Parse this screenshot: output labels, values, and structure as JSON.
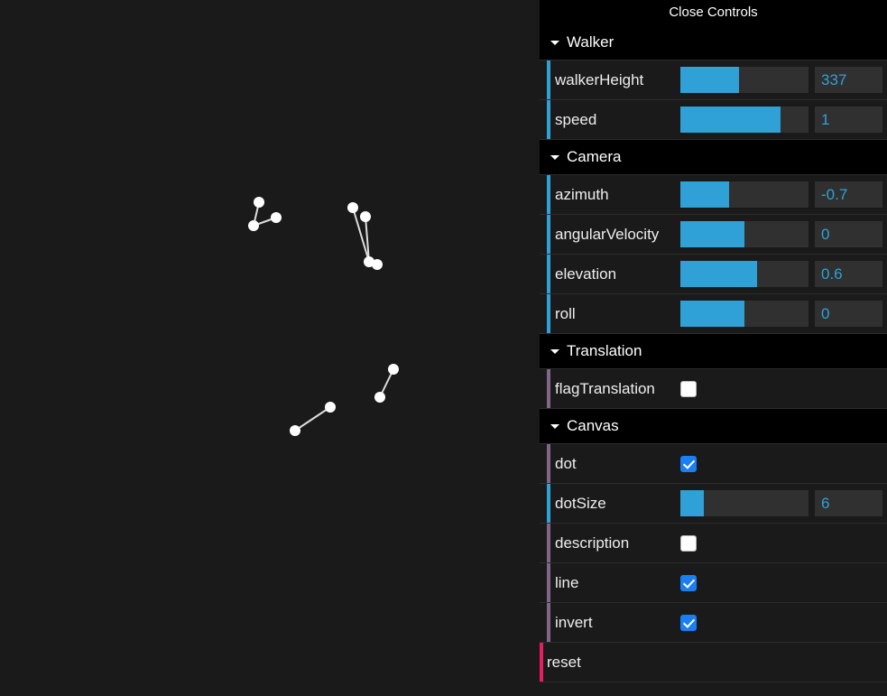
{
  "close_label": "Close Controls",
  "canvas": {
    "background": "#1a1a1a",
    "dot_color": "#ffffff",
    "line_color": "#dddddd",
    "dot_radius": 6,
    "clusters": [
      {
        "dots": [
          [
            287,
            224
          ],
          [
            281,
            250
          ],
          [
            306,
            241
          ]
        ],
        "lines": [
          [
            0,
            1
          ],
          [
            1,
            2
          ]
        ]
      },
      {
        "dots": [
          [
            391,
            230
          ],
          [
            405,
            240
          ],
          [
            409,
            290
          ],
          [
            418,
            293
          ]
        ],
        "lines": [
          [
            0,
            2
          ],
          [
            1,
            2
          ],
          [
            2,
            3
          ]
        ]
      },
      {
        "dots": [
          [
            327,
            477
          ],
          [
            366,
            451
          ]
        ],
        "lines": [
          [
            0,
            1
          ]
        ]
      },
      {
        "dots": [
          [
            436,
            409
          ],
          [
            421,
            440
          ]
        ],
        "lines": [
          [
            0,
            1
          ]
        ]
      }
    ]
  },
  "accents": {
    "slider": "#2fa1d6",
    "boolean": "#806787",
    "function": "#e61d5f",
    "value_text": "#2fa1d6",
    "checkbox_on": "#1a7ef5"
  },
  "folders": [
    {
      "title": "Walker",
      "rows": [
        {
          "type": "slider",
          "label": "walkerHeight",
          "value": "337",
          "fill": 46
        },
        {
          "type": "slider",
          "label": "speed",
          "value": "1",
          "fill": 78
        }
      ]
    },
    {
      "title": "Camera",
      "rows": [
        {
          "type": "slider",
          "label": "azimuth",
          "value": "-0.7",
          "fill": 38
        },
        {
          "type": "slider",
          "label": "angularVelocity",
          "value": "0",
          "fill": 50
        },
        {
          "type": "slider",
          "label": "elevation",
          "value": "0.6",
          "fill": 60
        },
        {
          "type": "slider",
          "label": "roll",
          "value": "0",
          "fill": 50
        }
      ]
    },
    {
      "title": "Translation",
      "rows": [
        {
          "type": "boolean",
          "label": "flagTranslation",
          "checked": false
        }
      ]
    },
    {
      "title": "Canvas",
      "rows": [
        {
          "type": "boolean",
          "label": "dot",
          "checked": true
        },
        {
          "type": "slider",
          "label": "dotSize",
          "value": "6",
          "fill": 18
        },
        {
          "type": "boolean",
          "label": "description",
          "checked": false
        },
        {
          "type": "boolean",
          "label": "line",
          "checked": true
        },
        {
          "type": "boolean",
          "label": "invert",
          "checked": true
        },
        {
          "type": "function",
          "label": "reset"
        }
      ]
    }
  ]
}
